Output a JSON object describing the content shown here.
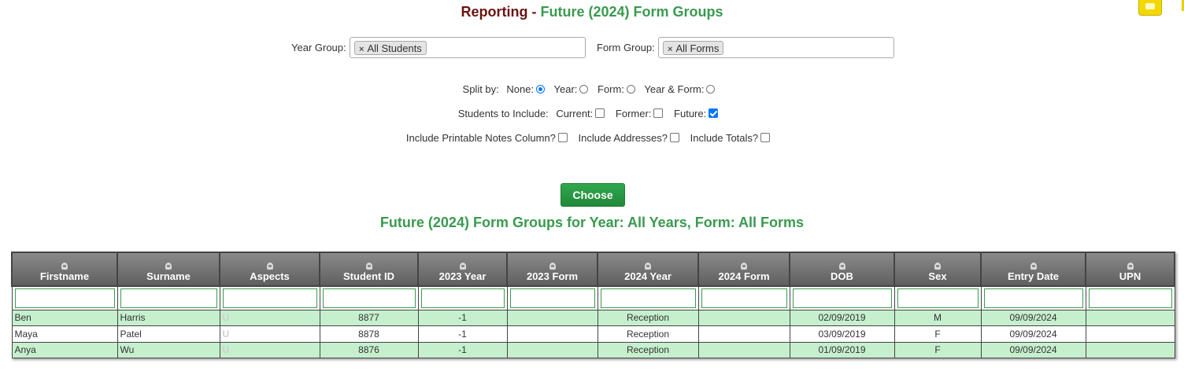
{
  "page": {
    "title_prefix": "Reporting -",
    "title_main": "Future (2024) Form Groups"
  },
  "filters": {
    "year_group_label": "Year Group:",
    "year_group_tag": "All Students",
    "form_group_label": "Form Group:",
    "form_group_tag": "All Forms",
    "tag_remove_glyph": "×"
  },
  "split_by": {
    "label": "Split by:",
    "options": [
      {
        "label": "None:",
        "selected": true
      },
      {
        "label": "Year:",
        "selected": false
      },
      {
        "label": "Form:",
        "selected": false
      },
      {
        "label": "Year & Form:",
        "selected": false
      }
    ]
  },
  "students_to_include": {
    "label": "Students to Include:",
    "options": [
      {
        "label": "Current:",
        "checked": false
      },
      {
        "label": "Former:",
        "checked": false
      },
      {
        "label": "Future:",
        "checked": true
      }
    ]
  },
  "extra_options": [
    {
      "label": "Include Printable Notes Column?",
      "checked": false
    },
    {
      "label": "Include Addresses?",
      "checked": false
    },
    {
      "label": "Include Totals?",
      "checked": false
    }
  ],
  "choose_button": "Choose",
  "results_title": "Future (2024) Form Groups for Year: All Years, Form: All Forms",
  "table": {
    "columns": [
      "Firstname",
      "Surname",
      "Aspects",
      "Student ID",
      "2023 Year",
      "2023 Form",
      "2024 Year",
      "2024 Form",
      "DOB",
      "Sex",
      "Entry Date",
      "UPN"
    ],
    "rows": [
      [
        "Ben",
        "Harris",
        "U",
        "8877",
        "-1",
        "",
        "Reception",
        "",
        "02/09/2019",
        "M",
        "09/09/2024",
        ""
      ],
      [
        "Maya",
        "Patel",
        "U",
        "8878",
        "-1",
        "",
        "Reception",
        "",
        "03/09/2019",
        "F",
        "09/09/2024",
        ""
      ],
      [
        "Anya",
        "Wu",
        "U",
        "8876",
        "-1",
        "",
        "Reception",
        "",
        "01/09/2019",
        "F",
        "09/09/2024",
        ""
      ]
    ]
  },
  "colors": {
    "title_prefix": "#6b1410",
    "title_accent": "#3a9a4f",
    "button_green": "#28a745",
    "row_highlight": "#c6efce",
    "header_grey": "#707070"
  },
  "icons": {
    "column_sort": "sort-icon",
    "corner": "print-icon"
  }
}
